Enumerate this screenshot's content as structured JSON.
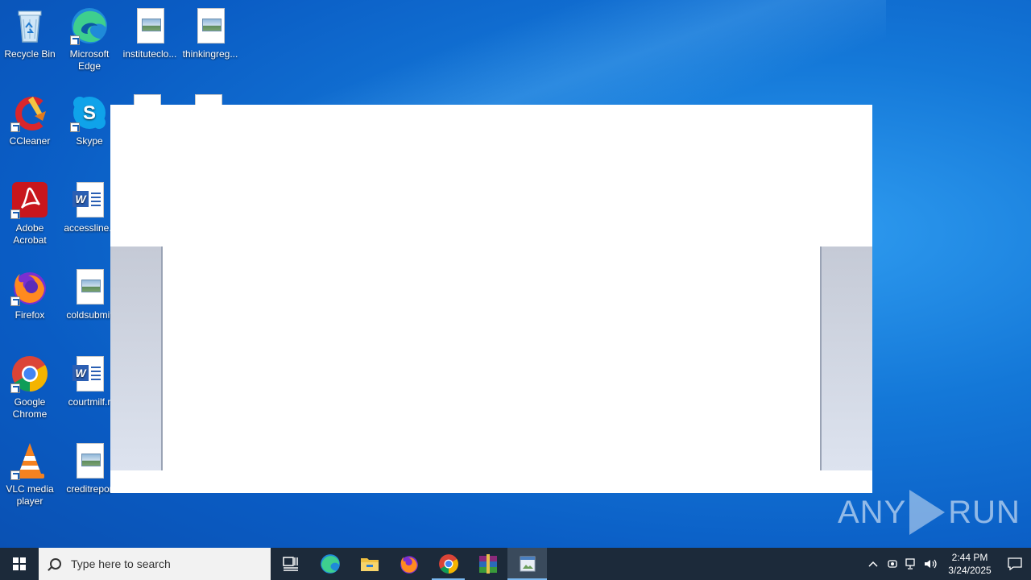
{
  "desktop": {
    "icons": [
      {
        "label": "Recycle Bin",
        "icon": "recycle-bin-icon"
      },
      {
        "label": "Microsoft Edge",
        "icon": "edge-icon"
      },
      {
        "label": "instituteclo...",
        "icon": "image-file-icon"
      },
      {
        "label": "thinkingreg...",
        "icon": "image-file-icon"
      },
      {
        "label": "CCleaner",
        "icon": "ccleaner-icon"
      },
      {
        "label": "Skype",
        "icon": "skype-icon"
      },
      {
        "label": "Adobe Acrobat",
        "icon": "acrobat-icon"
      },
      {
        "label": "accessline.r",
        "icon": "word-doc-icon"
      },
      {
        "label": "Firefox",
        "icon": "firefox-icon"
      },
      {
        "label": "coldsubmit",
        "icon": "image-file-icon"
      },
      {
        "label": "Google Chrome",
        "icon": "chrome-icon"
      },
      {
        "label": "courtmilf.r",
        "icon": "word-doc-icon"
      },
      {
        "label": "VLC media player",
        "icon": "vlc-icon"
      },
      {
        "label": "creditrepor",
        "icon": "image-file-icon"
      }
    ]
  },
  "watermark": {
    "left": "ANY",
    "right": "RUN"
  },
  "taskbar": {
    "search_placeholder": "Type here to search",
    "apps": [
      {
        "name": "task-view",
        "icon": "task-view-icon"
      },
      {
        "name": "edge",
        "icon": "edge-icon"
      },
      {
        "name": "file-explorer",
        "icon": "folder-icon"
      },
      {
        "name": "firefox",
        "icon": "firefox-icon"
      },
      {
        "name": "chrome",
        "icon": "chrome-icon"
      },
      {
        "name": "winrar",
        "icon": "winrar-icon"
      },
      {
        "name": "image-viewer",
        "icon": "image-viewer-icon"
      }
    ],
    "clock": {
      "time": "2:44 PM",
      "date": "3/24/2025"
    }
  }
}
